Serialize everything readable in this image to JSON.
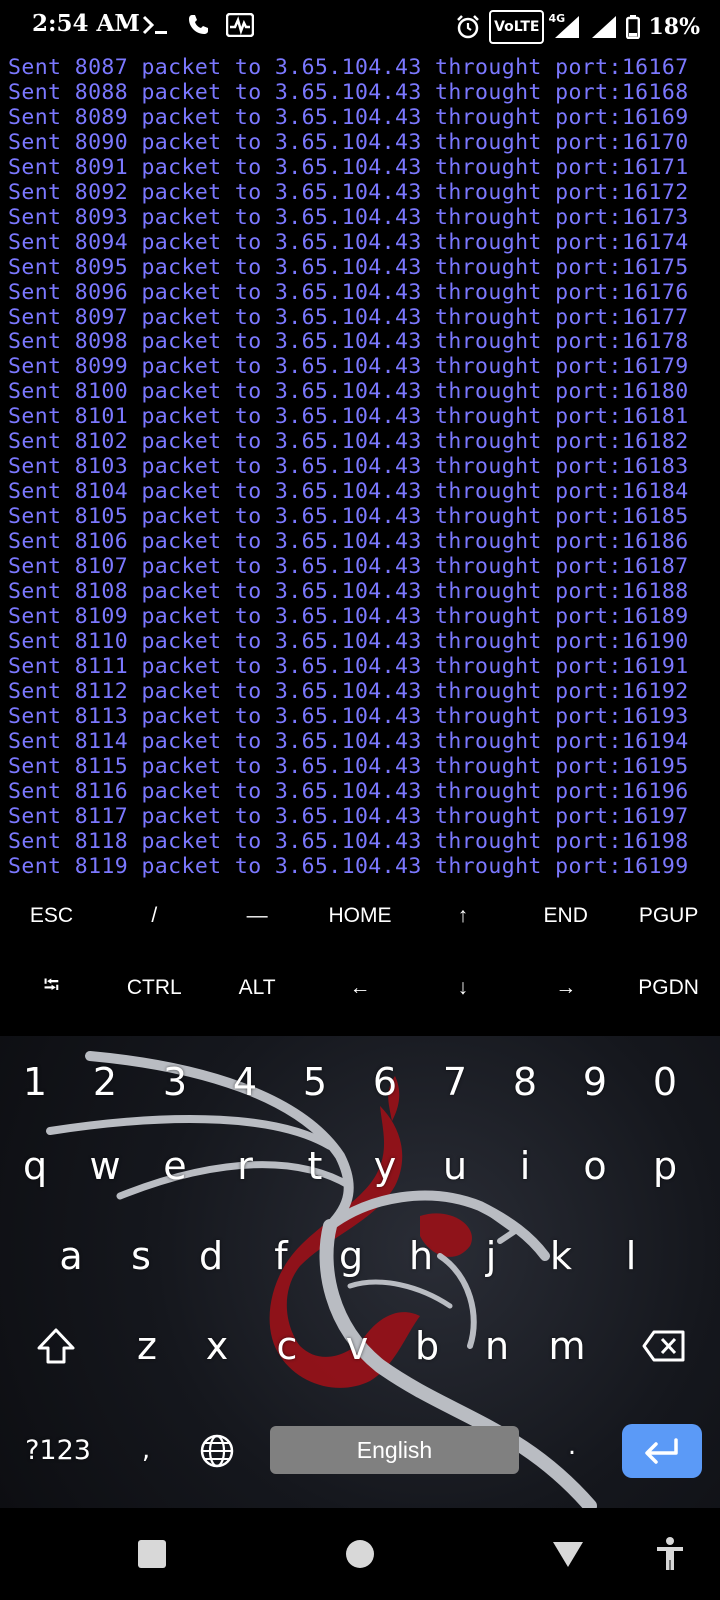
{
  "status_bar": {
    "time": "2:54 AM",
    "network": "4G",
    "volte": "VoLTE",
    "battery": "18%"
  },
  "terminal": {
    "text_color": "#7b78ff",
    "lines": [
      "Sent 8087 packet to 3.65.104.43 throught port:16167",
      "Sent 8088 packet to 3.65.104.43 throught port:16168",
      "Sent 8089 packet to 3.65.104.43 throught port:16169",
      "Sent 8090 packet to 3.65.104.43 throught port:16170",
      "Sent 8091 packet to 3.65.104.43 throught port:16171",
      "Sent 8092 packet to 3.65.104.43 throught port:16172",
      "Sent 8093 packet to 3.65.104.43 throught port:16173",
      "Sent 8094 packet to 3.65.104.43 throught port:16174",
      "Sent 8095 packet to 3.65.104.43 throught port:16175",
      "Sent 8096 packet to 3.65.104.43 throught port:16176",
      "Sent 8097 packet to 3.65.104.43 throught port:16177",
      "Sent 8098 packet to 3.65.104.43 throught port:16178",
      "Sent 8099 packet to 3.65.104.43 throught port:16179",
      "Sent 8100 packet to 3.65.104.43 throught port:16180",
      "Sent 8101 packet to 3.65.104.43 throught port:16181",
      "Sent 8102 packet to 3.65.104.43 throught port:16182",
      "Sent 8103 packet to 3.65.104.43 throught port:16183",
      "Sent 8104 packet to 3.65.104.43 throught port:16184",
      "Sent 8105 packet to 3.65.104.43 throught port:16185",
      "Sent 8106 packet to 3.65.104.43 throught port:16186",
      "Sent 8107 packet to 3.65.104.43 throught port:16187",
      "Sent 8108 packet to 3.65.104.43 throught port:16188",
      "Sent 8109 packet to 3.65.104.43 throught port:16189",
      "Sent 8110 packet to 3.65.104.43 throught port:16190",
      "Sent 8111 packet to 3.65.104.43 throught port:16191",
      "Sent 8112 packet to 3.65.104.43 throught port:16192",
      "Sent 8113 packet to 3.65.104.43 throught port:16193",
      "Sent 8114 packet to 3.65.104.43 throught port:16194",
      "Sent 8115 packet to 3.65.104.43 throught port:16195",
      "Sent 8116 packet to 3.65.104.43 throught port:16196",
      "Sent 8117 packet to 3.65.104.43 throught port:16197",
      "Sent 8118 packet to 3.65.104.43 throught port:16198",
      "Sent 8119 packet to 3.65.104.43 throught port:16199"
    ]
  },
  "extra_keys": {
    "row1": [
      "ESC",
      "/",
      "—",
      "HOME",
      "↑",
      "END",
      "PGUP"
    ],
    "row2": [
      "⭾",
      "CTRL",
      "ALT",
      "←",
      "↓",
      "→",
      "PGDN"
    ]
  },
  "keyboard": {
    "numbers": [
      "1",
      "2",
      "3",
      "4",
      "5",
      "6",
      "7",
      "8",
      "9",
      "0"
    ],
    "row_q": [
      "q",
      "w",
      "e",
      "r",
      "t",
      "y",
      "u",
      "i",
      "o",
      "p"
    ],
    "row_a": [
      "a",
      "s",
      "d",
      "f",
      "g",
      "h",
      "j",
      "k",
      "l"
    ],
    "row_z": [
      "z",
      "x",
      "c",
      "v",
      "b",
      "n",
      "m"
    ],
    "symbols_label": "?123",
    "comma": ",",
    "period": ".",
    "space_label": "English",
    "enter_color": "#5b9af7",
    "background_art": "kali-dragon"
  }
}
